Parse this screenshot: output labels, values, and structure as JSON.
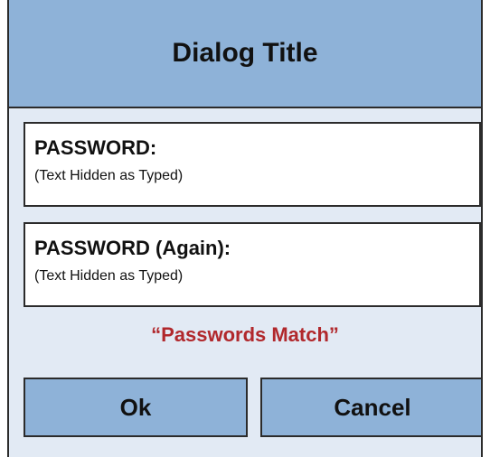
{
  "dialog": {
    "title": "Dialog Title",
    "fields": [
      {
        "label": "PASSWORD:",
        "hint": "(Text Hidden as Typed)"
      },
      {
        "label": "PASSWORD (Again):",
        "hint": "(Text Hidden as Typed)"
      }
    ],
    "status_message": "“Passwords Match”",
    "buttons": {
      "ok_label": "Ok",
      "cancel_label": "Cancel"
    }
  },
  "colors": {
    "title_bar": "#8eb2d8",
    "dialog_background": "#e2eaf4",
    "status_text": "#b1282c",
    "border": "#2b2b2b"
  }
}
